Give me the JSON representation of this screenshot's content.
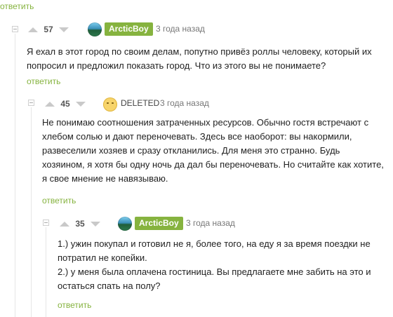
{
  "reply_label": "ответить",
  "colors": {
    "accent": "#86b33f",
    "line": "#e6e6e6",
    "arrow": "#c9c9c9"
  },
  "comments": [
    {
      "rating": "57",
      "author": "ArcticBoy",
      "avatar": "earth-avatar",
      "time": "3 года назад",
      "text": [
        "Я ехал в этот город по своим делам, попутно привёз роллы человеку, который их",
        "попросил и предложил показать город. Что из этого вы не понимаете?"
      ]
    },
    {
      "rating": "45",
      "author": "DELETED",
      "avatar": "emoji-avatar",
      "time": "3 года назад",
      "text": [
        "Не понимаю соотношения затраченных ресурсов. Обычно гостя встречают с",
        "хлебом солью и дают переночевать. Здесь все наоборот: вы накормили,",
        "развеселили хозяев и сразу  откланились. Для меня это странно. Будь",
        "хозяином, я хотя бы одну ночь да дал бы переночевать. Но считайте как хотите,",
        "я свое мнение не навязываю."
      ]
    },
    {
      "rating": "35",
      "author": "ArcticBoy",
      "avatar": "earth-avatar",
      "time": "3 года назад",
      "text": [
        "1.) ужин покупал и готовил не я, более того, на еду я за время поездки не",
        "потратил не копейки.",
        "2.) у меня была оплачена гостиница. Вы предлагаете мне забить на это и",
        "остаться спать на полу?"
      ]
    }
  ]
}
